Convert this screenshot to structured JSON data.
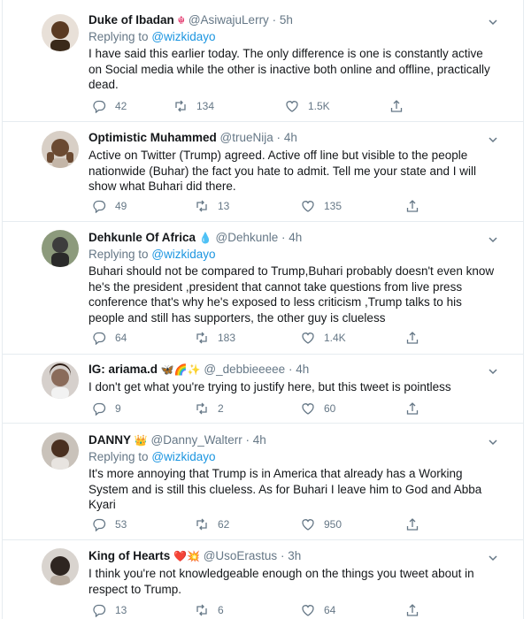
{
  "tweets": [
    {
      "name": "Duke of Ibadan",
      "emoji": "☬",
      "handle": "@AsiwajuLerry",
      "time": "5h",
      "reply_prefix": "Replying to",
      "reply_to": "@wizkidayo",
      "text": "I have said this earlier today. The only difference is one is constantly active on Social media while the other is inactive both online and offline, practically dead.",
      "replies": "42",
      "retweets": "134",
      "likes": "1.5K",
      "avatar_color": "#5a3a22"
    },
    {
      "name": "Optimistic Muhammed",
      "emoji": "",
      "handle": "@trueNija",
      "time": "4h",
      "reply_prefix": "",
      "reply_to": "",
      "text": "Active on Twitter (Trump) agreed. Active off line but visible to the people nationwide (Buhar) the fact you hate to admit. Tell me your state and I will show what Buhari did there.",
      "replies": "49",
      "retweets": "13",
      "likes": "135",
      "avatar_color": "#6b4a32"
    },
    {
      "name": "Dehkunle Of Africa",
      "emoji": "💧",
      "handle": "@Dehkunle",
      "time": "4h",
      "reply_prefix": "Replying to",
      "reply_to": "@wizkidayo",
      "text": "Buhari should not be compared to Trump,Buhari probably doesn't even know he's the president ,president that cannot take questions from live press conference that's why he's exposed to less criticism ,Trump talks to his people and still has supporters, the other guy is clueless",
      "replies": "64",
      "retweets": "183",
      "likes": "1.4K",
      "avatar_color": "#3d3d3d"
    },
    {
      "name": "IG: ariama.d",
      "emoji": "🦋🌈✨",
      "handle": "@_debbieeeee",
      "time": "4h",
      "reply_prefix": "",
      "reply_to": "",
      "text": "I don't get what you're trying to justify here, but this tweet is pointless",
      "replies": "9",
      "retweets": "2",
      "likes": "60",
      "avatar_color": "#8a6b5a"
    },
    {
      "name": "DANNY",
      "emoji": "👑",
      "handle": "@Danny_Walterr",
      "time": "4h",
      "reply_prefix": "Replying to",
      "reply_to": "@wizkidayo",
      "text": "It's more annoying that Trump is in America that already has a Working System and is still this clueless. As for Buhari I leave him to God and Abba Kyari",
      "replies": "53",
      "retweets": "62",
      "likes": "950",
      "avatar_color": "#4a3020"
    },
    {
      "name": "King of Hearts",
      "emoji": "❤️💥",
      "handle": "@UsoErastus",
      "time": "3h",
      "reply_prefix": "",
      "reply_to": "",
      "text": "I think you're not knowledgeable enough on the things you tweet about in respect to Trump.",
      "replies": "13",
      "retweets": "6",
      "likes": "64",
      "avatar_color": "#2e2520"
    }
  ],
  "colors": {
    "text": "#14171a",
    "muted": "#657786",
    "link": "#1b95e0",
    "divider": "#e6ecf0"
  },
  "icons": [
    "reply-icon",
    "retweet-icon",
    "like-icon",
    "share-icon",
    "caret-down-icon"
  ]
}
